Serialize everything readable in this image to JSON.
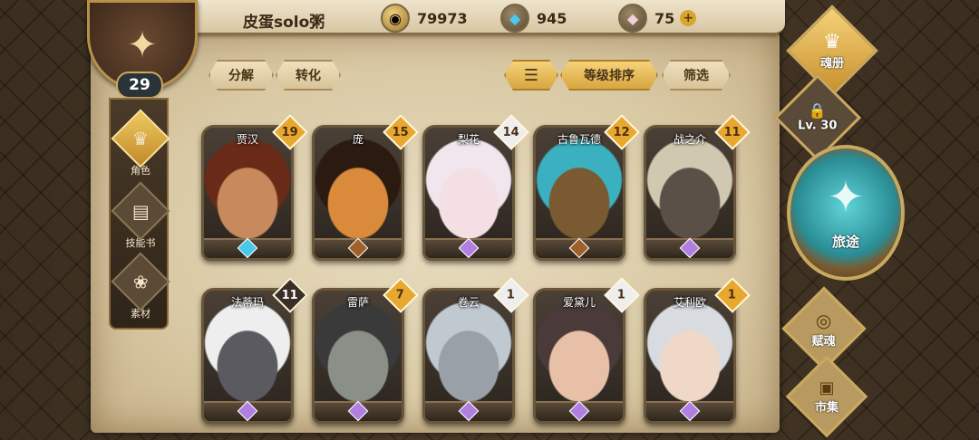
{
  "player": {
    "name": "皮蛋solo粥",
    "level": "29"
  },
  "currencies": [
    {
      "icon": "gold-coin-icon",
      "value": "79973"
    },
    {
      "icon": "blue-crystal-icon",
      "value": "945"
    },
    {
      "icon": "pink-gem-icon",
      "value": "75"
    }
  ],
  "left_nav": [
    {
      "label": "角色",
      "active": true
    },
    {
      "label": "技能书",
      "active": false
    },
    {
      "label": "素材",
      "active": false
    }
  ],
  "toolbar": {
    "decompose": "分解",
    "convert": "转化",
    "sort_level": "等级排序",
    "filter": "筛选"
  },
  "right_menu": {
    "soul_book": "魂册",
    "locked_level": "Lv. 30",
    "journey": "旅途",
    "fuhun": "赋魂",
    "market": "市集"
  },
  "heroes": [
    {
      "name": "贾汉",
      "level": "19",
      "badge_color": "#e8a830",
      "skin": "#c8895c",
      "hair": "#6a2a18",
      "gem": "#4ac8e8"
    },
    {
      "name": "庞",
      "level": "15",
      "badge_color": "#e8a830",
      "skin": "#d98a3a",
      "hair": "#2a1a10",
      "gem": "#a0602a"
    },
    {
      "name": "梨花",
      "level": "14",
      "badge_color": "#eeeeee",
      "skin": "#f4e0e4",
      "hair": "#f2e6ee",
      "gem": "#b080e0"
    },
    {
      "name": "古鲁瓦德",
      "level": "12",
      "badge_color": "#e8a830",
      "skin": "#7a5a30",
      "hair": "#3ab0c0",
      "gem": "#a0602a"
    },
    {
      "name": "战之介",
      "level": "11",
      "badge_color": "#e8a830",
      "skin": "#5a5048",
      "hair": "#d0c8b0",
      "gem": "#b080e0"
    },
    {
      "name": "法蒂玛",
      "level": "11",
      "badge_color": "#3a2e26",
      "skin": "#5a5a60",
      "hair": "#eeeeee",
      "gem": "#b080e0"
    },
    {
      "name": "雷萨",
      "level": "7",
      "badge_color": "#e8a830",
      "skin": "#8a9088",
      "hair": "#3a3a3a",
      "gem": "#b080e0"
    },
    {
      "name": "卷云",
      "level": "1",
      "badge_color": "#eeeeee",
      "skin": "#9aa0a8",
      "hair": "#c0c8d0",
      "gem": "#b080e0"
    },
    {
      "name": "爱黛儿",
      "level": "1",
      "badge_color": "#eeeeee",
      "skin": "#e8c0a8",
      "hair": "#4a3a3a",
      "gem": "#b080e0"
    },
    {
      "name": "艾利欧",
      "level": "1",
      "badge_color": "#e8a830",
      "skin": "#f0d8c8",
      "hair": "#d8dce0",
      "gem": "#b080e0"
    }
  ]
}
